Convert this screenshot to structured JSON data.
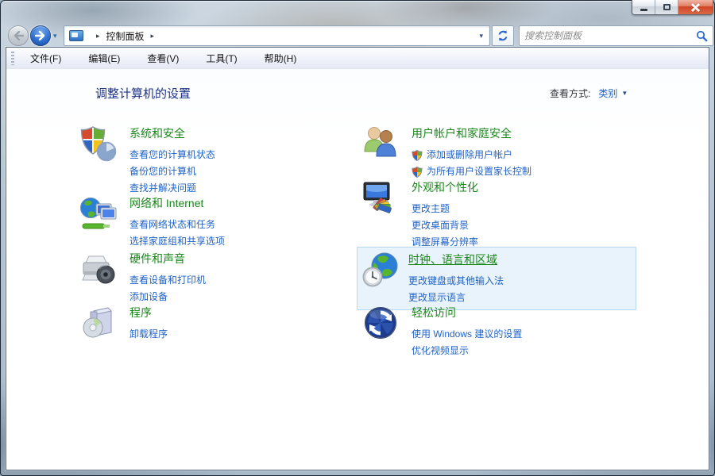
{
  "window": {
    "controls": {
      "minimize": "minimize",
      "maximize": "maximize",
      "close": "close"
    }
  },
  "nav": {
    "back": "back",
    "forward": "forward",
    "history_dropdown_arrow": "▾",
    "breadcrumb": {
      "arrow": "▸",
      "item": "控制面板"
    },
    "address_dropdown_arrow": "▾",
    "refresh": "refresh",
    "search": {
      "placeholder": "搜索控制面板"
    }
  },
  "menubar": {
    "items": [
      "文件(F)",
      "编辑(E)",
      "查看(V)",
      "工具(T)",
      "帮助(H)"
    ]
  },
  "header": {
    "title": "调整计算机的设置",
    "view_label": "查看方式:",
    "view_value": "类别",
    "view_arrow": "▼"
  },
  "main": {
    "columns": [
      {
        "categories": [
          {
            "id": "system-security",
            "title": "系统和安全",
            "links": [
              {
                "label": "查看您的计算机状态"
              },
              {
                "label": "备份您的计算机"
              },
              {
                "label": "查找并解决问题"
              }
            ]
          },
          {
            "id": "network-internet",
            "title": "网络和 Internet",
            "links": [
              {
                "label": "查看网络状态和任务"
              },
              {
                "label": "选择家庭组和共享选项"
              }
            ]
          },
          {
            "id": "hardware-sound",
            "title": "硬件和声音",
            "links": [
              {
                "label": "查看设备和打印机"
              },
              {
                "label": "添加设备"
              }
            ]
          },
          {
            "id": "programs",
            "title": "程序",
            "links": [
              {
                "label": "卸载程序"
              }
            ]
          }
        ]
      },
      {
        "categories": [
          {
            "id": "user-accounts",
            "title": "用户帐户和家庭安全",
            "links": [
              {
                "label": "添加或删除用户帐户",
                "shield": true
              },
              {
                "label": "为所有用户设置家长控制",
                "shield": true
              }
            ]
          },
          {
            "id": "appearance-personalization",
            "title": "外观和个性化",
            "links": [
              {
                "label": "更改主题"
              },
              {
                "label": "更改桌面背景"
              },
              {
                "label": "调整屏幕分辨率"
              }
            ]
          },
          {
            "id": "clock-language-region",
            "title": "时钟、语言和区域",
            "highlighted": true,
            "links": [
              {
                "label": "更改键盘或其他输入法"
              },
              {
                "label": "更改显示语言"
              }
            ]
          },
          {
            "id": "ease-of-access",
            "title": "轻松访问",
            "links": [
              {
                "label": "使用 Windows 建议的设置"
              },
              {
                "label": "优化视频显示"
              }
            ]
          }
        ]
      }
    ]
  },
  "colors": {
    "category_title": "#1a871a",
    "link": "#2163c5",
    "page_title": "#1d3287",
    "highlight_bg": "#e9f3fb",
    "highlight_border": "#b5d7ef",
    "close_button": "#cf4526"
  }
}
